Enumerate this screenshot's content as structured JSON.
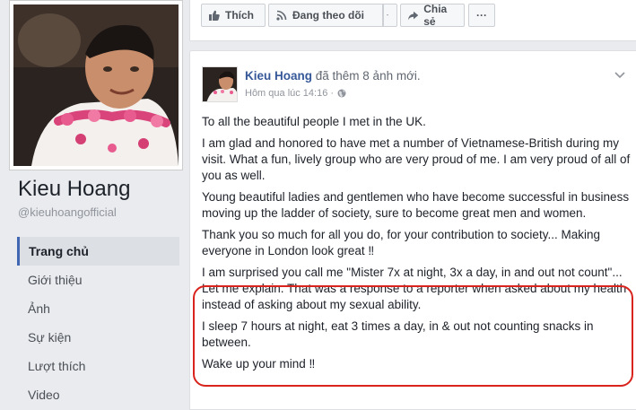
{
  "sidebar": {
    "page_name": "Kieu Hoang",
    "handle": "@kieuhoangofficial",
    "nav": [
      {
        "label": "Trang chủ",
        "active": true
      },
      {
        "label": "Giới thiệu",
        "active": false
      },
      {
        "label": "Ảnh",
        "active": false
      },
      {
        "label": "Sự kiện",
        "active": false
      },
      {
        "label": "Lượt thích",
        "active": false
      },
      {
        "label": "Video",
        "active": false
      }
    ]
  },
  "actionbar": {
    "like_label": "Thích",
    "follow_label": "Đang theo dõi",
    "share_label": "Chia sẻ",
    "more_label": "···"
  },
  "post": {
    "author": "Kieu Hoang",
    "action_text": " đã thêm 8 ảnh mới.",
    "timestamp": "Hôm qua lúc 14:16 ·",
    "paragraphs": [
      "To all the beautiful people I met in the UK.",
      "I am glad and honored to have met a number of Vietnamese-British during my visit. What a fun, lively group who are very proud of me. I am very proud of all of you as well.",
      "Young beautiful ladies and gentlemen who have become successful in business moving up the ladder of society, sure to become great men and women.",
      "Thank you so much for all you do, for your contribution to society... Making everyone in London look great ‼",
      "I am surprised you call me \"Mister 7x at night, 3x a day, in and out not count\"... Let me explain. That was a response to a reporter when asked about my health instead of asking about my sexual ability.",
      "I sleep 7 hours at night, eat 3 times a day, in & out not counting snacks in between.",
      "Wake up your mind ‼"
    ]
  },
  "colors": {
    "link": "#365899",
    "highlight_box": "#d9231d",
    "nav_active_bar": "#4267b2"
  },
  "icons": [
    "thumbs-up-icon",
    "rss-icon",
    "caret-down-icon",
    "share-arrow-icon",
    "more-icon",
    "globe-icon"
  ]
}
